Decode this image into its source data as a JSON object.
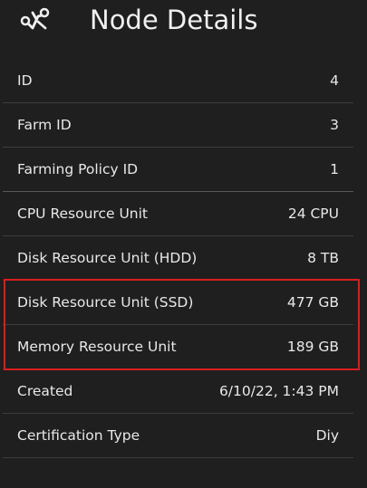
{
  "header": {
    "title": "Node Details",
    "icon": "node-network-icon"
  },
  "rows": [
    {
      "label": "ID",
      "value": "4"
    },
    {
      "label": "Farm ID",
      "value": "3"
    },
    {
      "label": "Farming Policy ID",
      "value": "1"
    },
    {
      "label": "CPU Resource Unit",
      "value": "24 CPU"
    },
    {
      "label": "Disk Resource Unit (HDD)",
      "value": "8 TB"
    },
    {
      "label": "Disk Resource Unit (SSD)",
      "value": "477 GB"
    },
    {
      "label": "Memory Resource Unit",
      "value": "189 GB"
    },
    {
      "label": "Created",
      "value": "6/10/22, 1:43 PM"
    },
    {
      "label": "Certification Type",
      "value": "Diy"
    }
  ],
  "colors": {
    "background": "#1f1f1f",
    "text": "#e8e8e8",
    "highlight": "#d81e1e"
  }
}
